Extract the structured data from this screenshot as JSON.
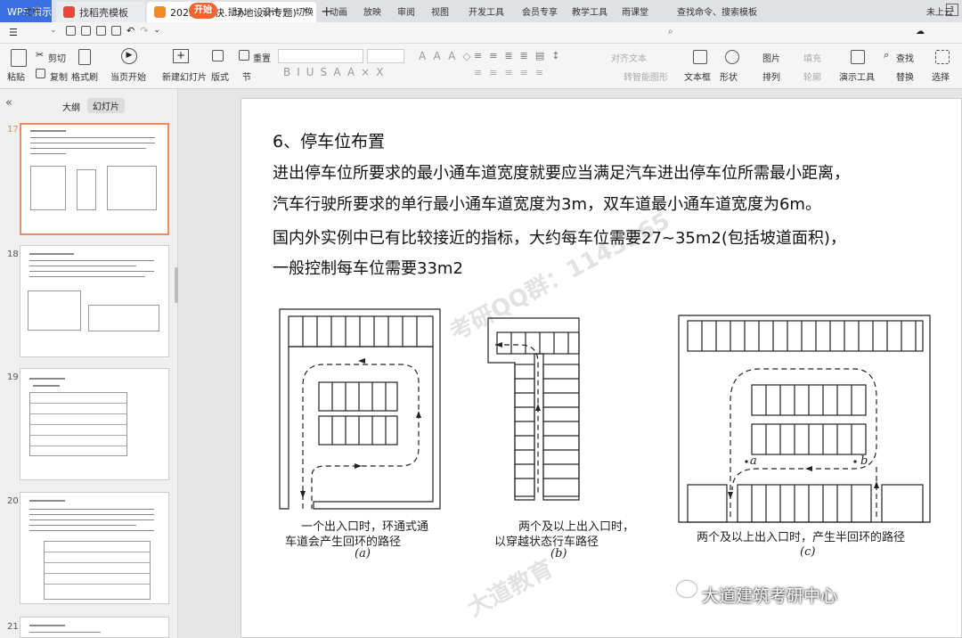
{
  "tabs": {
    "app": "WPS 演示",
    "template": "找稻壳模板",
    "doc": "2023秋李快...场地设计专题)"
  },
  "menu": {
    "file": "文件",
    "items": [
      "开始",
      "插入",
      "设计",
      "切换",
      "动画",
      "放映",
      "审阅",
      "视图",
      "开发工具",
      "会员专享",
      "教学工具",
      "雨课堂"
    ],
    "search": "查找命令、搜索模板",
    "cloud": "未上云"
  },
  "ribbon": {
    "paste": "粘贴",
    "cut": "剪切",
    "copy": "复制",
    "format_painter": "格式刷",
    "from_current": "当页开始",
    "new_slide": "新建幻灯片",
    "layout": "版式",
    "section": "节",
    "reset": "重置",
    "align_text": "对齐文本",
    "convert_smartart": "转智能图形",
    "textbox": "文本框",
    "shape": "形状",
    "arrange": "排列",
    "picture": "图片",
    "fill": "填充",
    "outline": "轮廓",
    "demo_tools": "演示工具",
    "find": "查找",
    "replace": "替换",
    "select": "选择"
  },
  "panel": {
    "outline_tab": "大纲",
    "slides_tab": "幻灯片",
    "thumb_numbers": [
      "17",
      "18",
      "19",
      "20",
      "21"
    ]
  },
  "slide": {
    "title": "6、停车位布置",
    "lines": [
      "进出停车位所要求的最小通车道宽度就要应当满足汽车进出停车位所需最小距离，",
      "汽车行驶所要求的单行最小通车道宽度为3m，双车道最小通车道宽度为6m。",
      "国内外实例中已有比较接近的指标，大约每车位需要27~35m2(包括坡道面积)，",
      "一般控制每车位需要33m2"
    ],
    "cap_a_1": "一个出入口时，环通式通",
    "cap_a_2": "车道会产生回环的路径",
    "cap_a_label": "(a)",
    "cap_b_1": "两个及以上出入口时，",
    "cap_b_2": "以穿越状态行车路径",
    "cap_b_label": "(b)",
    "cap_c_1": "两个及以上出入口时，产生半回环的路径",
    "cap_c_label": "(c)",
    "point_a": "a",
    "point_b": "b",
    "watermark_1": "考研QQ群：1145965",
    "watermark_2": "大道教育",
    "footer": "大道建筑考研中心"
  }
}
